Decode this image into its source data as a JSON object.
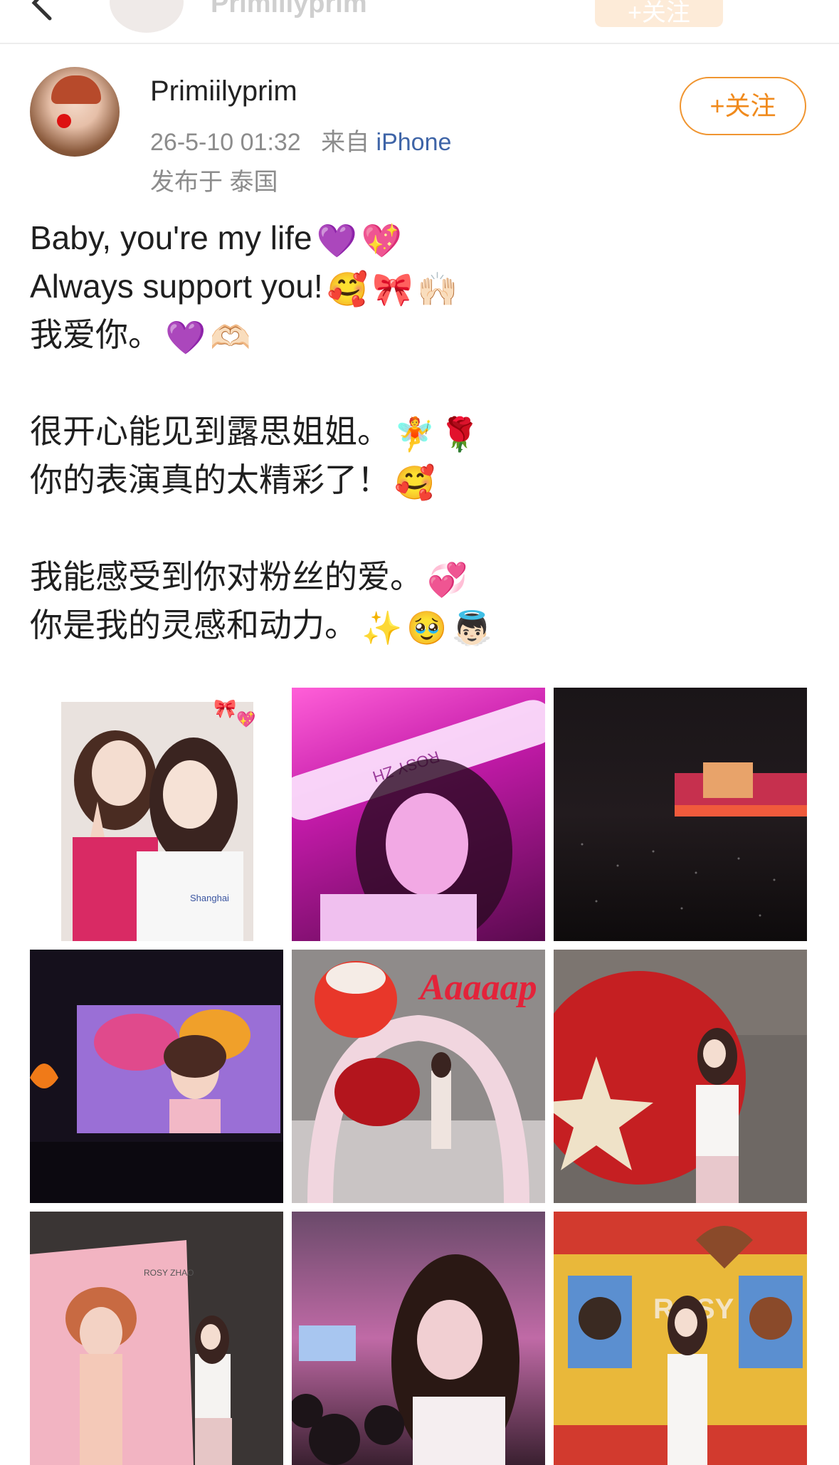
{
  "nav": {
    "back_icon": "chevron-left-icon",
    "title_name": "Primiilyprim",
    "follow_label": "+关注"
  },
  "author": {
    "name": "Primiilyprim",
    "timestamp": "26-5-10 01:32",
    "source_prefix": "来自",
    "source_device": "iPhone",
    "location": "发布于 泰国",
    "follow_label": "+关注"
  },
  "post": {
    "lines": [
      {
        "text": "Baby, you're my life",
        "emojis": [
          "💜",
          "💖"
        ]
      },
      {
        "text": "Always support you!",
        "emojis": [
          "🥰",
          "🎀",
          "🙌🏻"
        ]
      },
      {
        "text": "我爱你。",
        "emojis": [
          "💜",
          "🫶🏻"
        ]
      },
      {
        "text": "",
        "emojis": []
      },
      {
        "text": "很开心能见到露思姐姐。",
        "emojis": [
          "🧚",
          "🌹"
        ]
      },
      {
        "text": "你的表演真的太精彩了！",
        "emojis": [
          "🥰"
        ]
      },
      {
        "text": "",
        "emojis": []
      },
      {
        "text": "我能感受到你对粉丝的爱。",
        "emojis": [
          "💞"
        ]
      },
      {
        "text": "你是我的灵感和动力。",
        "emojis": [
          "✨",
          "🥹",
          "👼🏻"
        ]
      }
    ]
  },
  "images": [
    {
      "name": "photo-selfie-two-women",
      "caption_text": "Shanghai"
    },
    {
      "name": "photo-lightstick-selfie",
      "caption_text": "ROSY ZH"
    },
    {
      "name": "photo-concert-stage-wide",
      "caption_text": ""
    },
    {
      "name": "photo-concert-screen",
      "caption_text": ""
    },
    {
      "name": "photo-apple-arch-installation",
      "caption_text": "Aaaaap"
    },
    {
      "name": "photo-giant-apple-pose",
      "caption_text": ""
    },
    {
      "name": "photo-poster-wall",
      "caption_text": "ROSY ZHAO"
    },
    {
      "name": "photo-crowd-selfie",
      "caption_text": ""
    },
    {
      "name": "photo-cartoon-wall",
      "caption_text": "ROSY"
    }
  ],
  "colors": {
    "accent_orange": "#f08a1c",
    "link_blue": "#3e64a7",
    "meta_gray": "#8c8c8c"
  }
}
